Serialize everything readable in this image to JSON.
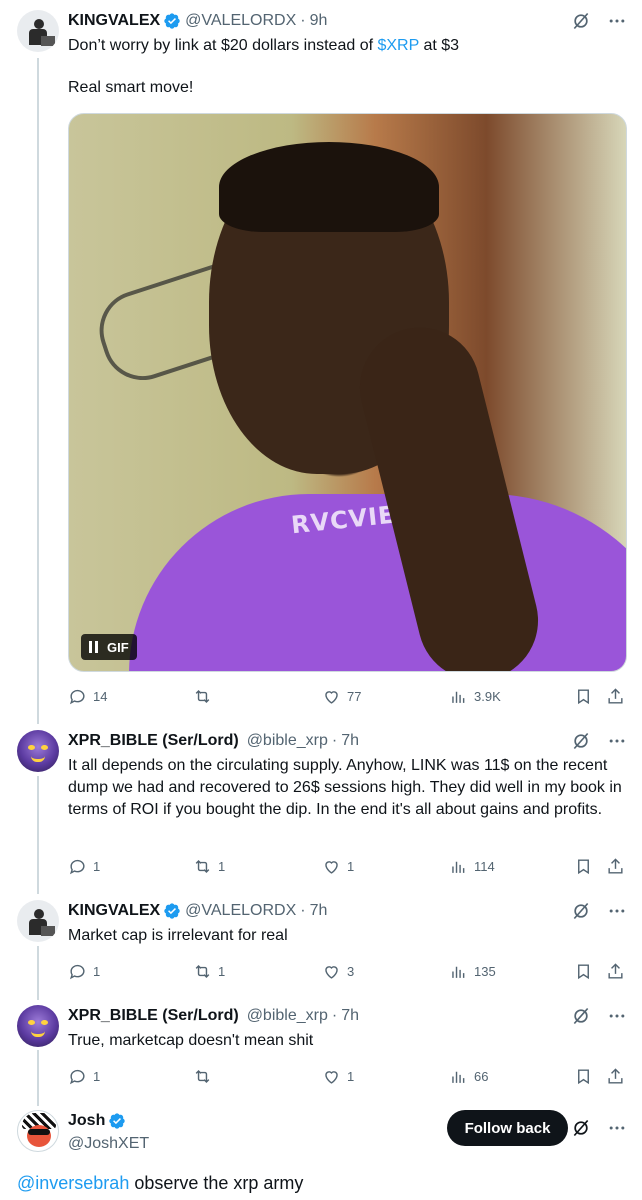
{
  "tweets": [
    {
      "name": "KINGVALEX",
      "handle": "@VALELORDX",
      "time": "9h",
      "text_before": "Don’t worry by link at $20 dollars instead of ",
      "cashtag": "$XRP",
      "text_after": " at $3",
      "text_line2": "Real smart move!",
      "media": {
        "type": "GIF",
        "badge_label": "GIF",
        "shirt_text": "RVCVIE"
      },
      "replies": "14",
      "reposts": "",
      "likes": "77",
      "views": "3.9K"
    },
    {
      "name": "XPR_BIBLE (Ser/Lord)",
      "handle": "@bible_xrp",
      "time": "7h",
      "text": "It all depends on the circulating supply. Anyhow, LINK was 11$ on the recent dump we had and recovered to 26$ sessions high. They did well in my book in terms of ROI if you bought the dip. In the end it's all about gains and profits.",
      "replies": "1",
      "reposts": "1",
      "likes": "1",
      "views": "114"
    },
    {
      "name": "KINGVALEX",
      "handle": "@VALELORDX",
      "time": "7h",
      "text": "Market cap is irrelevant for real",
      "replies": "1",
      "reposts": "1",
      "likes": "3",
      "views": "135"
    },
    {
      "name": "XPR_BIBLE (Ser/Lord)",
      "handle": "@bible_xrp",
      "time": "7h",
      "text": "True, marketcap doesn't mean shit",
      "replies": "1",
      "reposts": "",
      "likes": "1",
      "views": "66"
    }
  ],
  "main": {
    "name": "Josh",
    "handle": "@JoshXET",
    "follow_label": "Follow back",
    "mention": "@inversebrah",
    "text": " observe the xrp army"
  },
  "icons": {
    "grok": "grok-icon",
    "more": "more-icon",
    "reply": "reply-icon",
    "repost": "repost-icon",
    "like": "like-icon",
    "views": "views-icon",
    "bookmark": "bookmark-icon",
    "share": "share-icon",
    "verified": "verified-icon"
  },
  "colors": {
    "accent": "#1d9bf0",
    "text": "#0f1419",
    "muted": "#536471"
  }
}
